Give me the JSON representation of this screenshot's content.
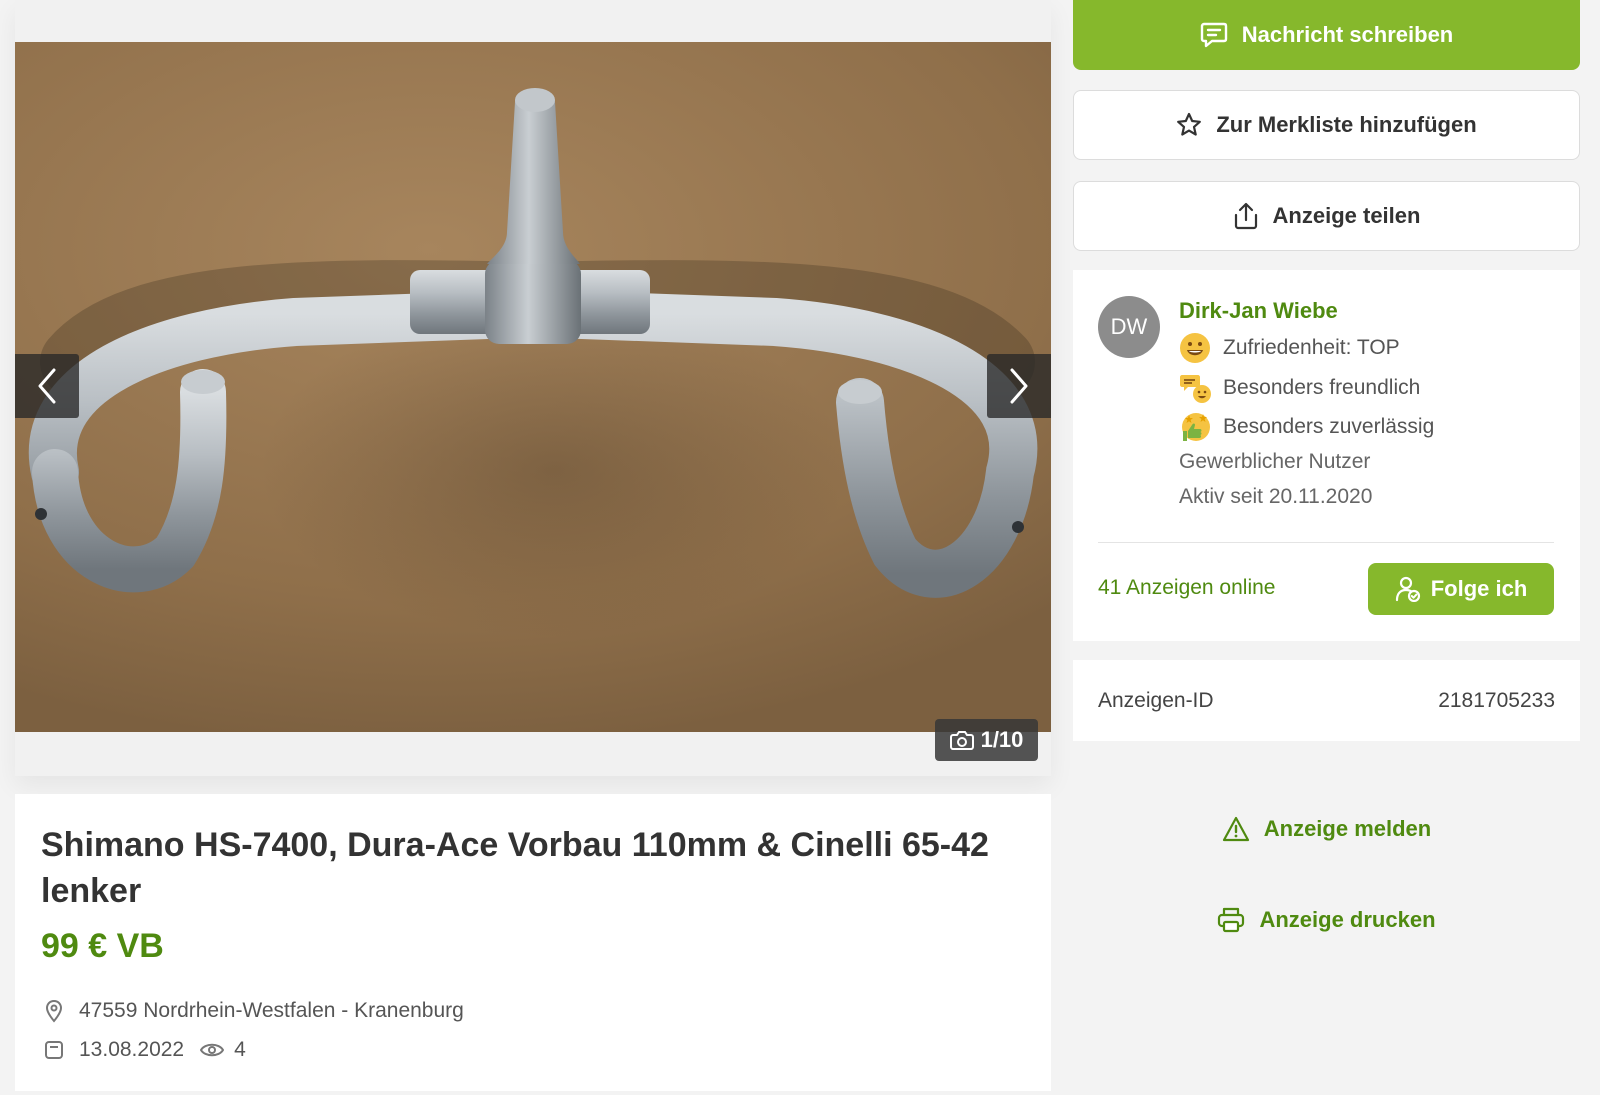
{
  "gallery": {
    "image_alt": "Silberner Rennradlenker mit Vorbau auf Korkuntergrund",
    "counter": "1/10",
    "prev_icon": "chevron-left-icon",
    "next_icon": "chevron-right-icon"
  },
  "listing": {
    "title": "Shimano HS-7400, Dura-Ace Vorbau 110mm & Cinelli 65-42 lenker",
    "price": "99 € VB",
    "location": "47559 Nordrhein-Westfalen - Kranenburg",
    "date": "13.08.2022",
    "views": "4"
  },
  "actions": {
    "message": "Nachricht schreiben",
    "watchlist": "Zur Merkliste hinzufügen",
    "share": "Anzeige teilen",
    "report": "Anzeige melden",
    "print": "Anzeige drucken"
  },
  "seller": {
    "initials": "DW",
    "name": "Dirk-Jan Wiebe",
    "badges": [
      {
        "label": "Zufriedenheit: TOP",
        "icon": "smiley-icon"
      },
      {
        "label": "Besonders freundlich",
        "icon": "chat-smiley-icon"
      },
      {
        "label": "Besonders zuverlässig",
        "icon": "thumbs-up-stars-icon"
      }
    ],
    "type": "Gewerblicher Nutzer",
    "active_since": "Aktiv seit 20.11.2020",
    "ads_online": "41 Anzeigen online",
    "follow": "Folge ich"
  },
  "ad_id": {
    "label": "Anzeigen-ID",
    "value": "2181705233"
  },
  "colors": {
    "brand_green": "#86b82c",
    "text_green": "#4f8a10",
    "background": "#f3f3f3"
  }
}
